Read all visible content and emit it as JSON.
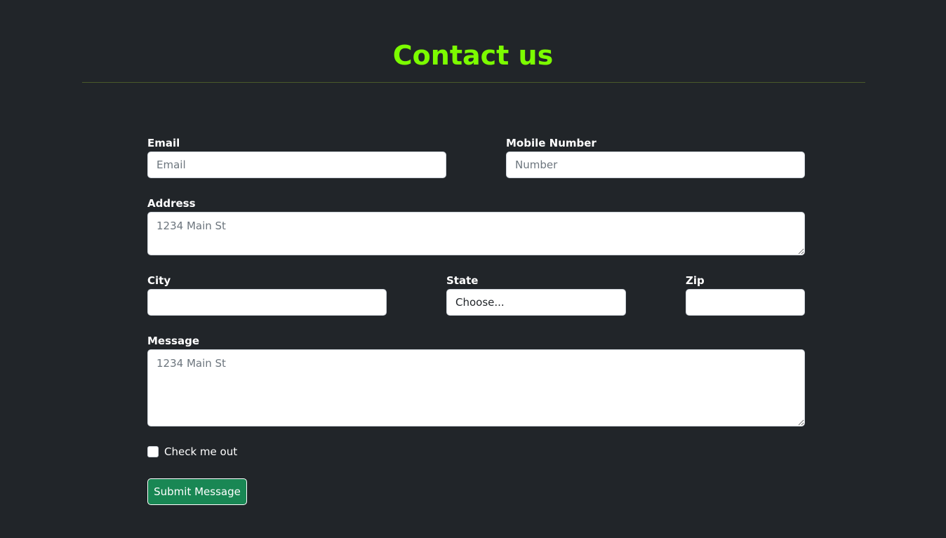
{
  "header": {
    "title": "Contact us"
  },
  "form": {
    "email": {
      "label": "Email",
      "placeholder": "Email"
    },
    "mobile": {
      "label": "Mobile Number",
      "placeholder": "Number"
    },
    "address": {
      "label": "Address",
      "placeholder": "1234 Main St"
    },
    "city": {
      "label": "City",
      "value": ""
    },
    "state": {
      "label": "State",
      "selected": "Choose..."
    },
    "zip": {
      "label": "Zip",
      "value": ""
    },
    "message": {
      "label": "Message",
      "placeholder": "1234 Main St"
    },
    "checkbox": {
      "label": "Check me out",
      "checked": false
    },
    "submit_label": "Submit Message"
  },
  "colors": {
    "background": "#212529",
    "title": "#7cfc00",
    "submit": "#198754"
  }
}
